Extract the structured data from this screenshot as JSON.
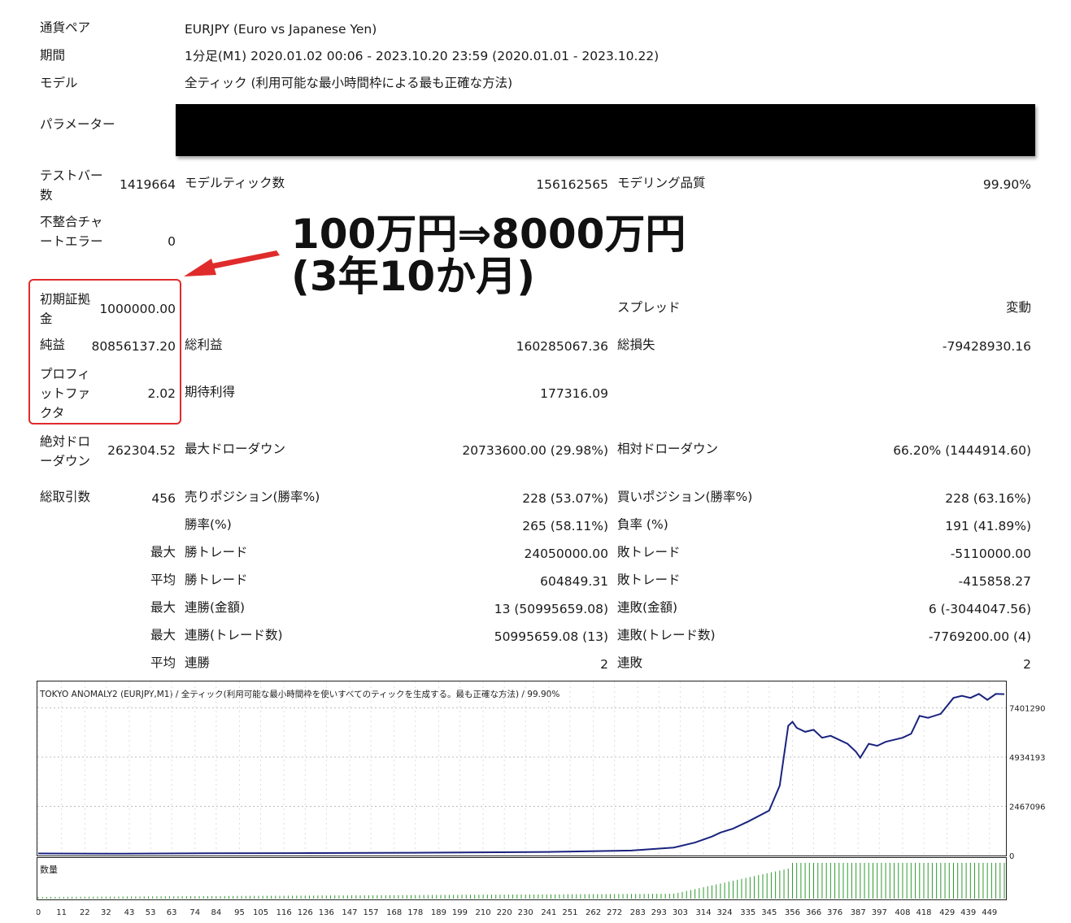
{
  "header": {
    "pair_label": "通貨ペア",
    "pair_value": "EURJPY (Euro vs Japanese Yen)",
    "period_label": "期間",
    "period_value": "1分足(M1) 2020.01.02 00:06 - 2023.10.20 23:59 (2020.01.01 - 2023.10.22)",
    "model_label": "モデル",
    "model_value": "全ティック (利用可能な最小時間枠による最も正確な方法)",
    "params_label": "パラメーター"
  },
  "stats": {
    "test_bars_label": "テストバー数",
    "test_bars_value": "1419664",
    "model_ticks_label": "モデルティック数",
    "model_ticks_value": "156162565",
    "modeling_quality_label": "モデリング品質",
    "modeling_quality_value": "99.90%",
    "mismatch_label": "不整合チャートエラー",
    "mismatch_value": "0",
    "initial_deposit_label": "初期証拠金",
    "initial_deposit_value": "1000000.00",
    "spread_label": "スプレッド",
    "spread_value": "変動",
    "net_profit_label": "純益",
    "net_profit_value": "80856137.20",
    "gross_profit_label": "総利益",
    "gross_profit_value": "160285067.36",
    "gross_loss_label": "総損失",
    "gross_loss_value": "-79428930.16",
    "profit_factor_label": "プロフィットファクタ",
    "profit_factor_value": "2.02",
    "expected_payoff_label": "期待利得",
    "expected_payoff_value": "177316.09",
    "abs_dd_label": "絶対ドローダウン",
    "abs_dd_value": "262304.52",
    "max_dd_label": "最大ドローダウン",
    "max_dd_value": "20733600.00 (29.98%)",
    "rel_dd_label": "相対ドローダウン",
    "rel_dd_value": "66.20% (1444914.60)",
    "total_trades_label": "総取引数",
    "total_trades_value": "456",
    "short_label": "売りポジション(勝率%)",
    "short_value": "228 (53.07%)",
    "long_label": "買いポジション(勝率%)",
    "long_value": "228 (63.16%)",
    "win_rate_label": "勝率(%)",
    "win_rate_value": "265 (58.11%)",
    "loss_rate_label": "負率 (%)",
    "loss_rate_value": "191 (41.89%)",
    "largest_label": "最大",
    "largest_win_label": "勝トレード",
    "largest_win_value": "24050000.00",
    "largest_loss_label": "敗トレード",
    "largest_loss_value": "-5110000.00",
    "average_label": "平均",
    "avg_win_label": "勝トレード",
    "avg_win_value": "604849.31",
    "avg_loss_label": "敗トレード",
    "avg_loss_value": "-415858.27",
    "max_consec_label": "最大",
    "max_consec_win_label": "連勝(金額)",
    "max_consec_win_value": "13 (50995659.08)",
    "max_consec_loss_label": "連敗(金額)",
    "max_consec_loss_value": "6 (-3044047.56)",
    "max_consec2_label": "最大",
    "max_consec_profit_label": "連勝(トレード数)",
    "max_consec_profit_value": "50995659.08 (13)",
    "max_consec_lossamt_label": "連敗(トレード数)",
    "max_consec_lossamt_value": "-7769200.00 (4)",
    "avg_consec_label": "平均",
    "avg_consec_win_label": "連勝",
    "avg_consec_win_value": "2",
    "avg_consec_loss_label": "連敗",
    "avg_consec_loss_value": "2"
  },
  "annotation": {
    "line1": "100万円⇒8000万円",
    "line2": "(3年10か月)",
    "box_color": "#e02b2b",
    "arrow_color": "#e02b2b"
  },
  "chart_data": {
    "type": "line",
    "title": "TOKYO ANOMALY2 (EURJPY,M1) / 全ティック(利用可能な最小時間枠を使いすべてのティックを生成する。最も正確な方法) / 99.90%",
    "volume_label": "数量",
    "y_tick_labels": [
      "7401290",
      "4934193",
      "2467096",
      "0"
    ],
    "y_ticks": [
      74012900,
      49341930,
      24670960,
      0
    ],
    "x_tick_labels": [
      "0",
      "11",
      "22",
      "32",
      "43",
      "53",
      "63",
      "74",
      "84",
      "95",
      "105",
      "116",
      "126",
      "136",
      "147",
      "157",
      "168",
      "178",
      "189",
      "199",
      "210",
      "220",
      "230",
      "241",
      "251",
      "262",
      "272",
      "283",
      "293",
      "303",
      "314",
      "324",
      "335",
      "345",
      "356",
      "366",
      "376",
      "387",
      "397",
      "408",
      "418",
      "429",
      "439",
      "449"
    ],
    "xlim": [
      0,
      456
    ],
    "ylim": [
      0,
      86000000
    ],
    "line_color": "#1a237e",
    "volume_color": "#2e9a2e",
    "series": [
      {
        "x": [
          0,
          40,
          80,
          120,
          160,
          200,
          240,
          280,
          300,
          310,
          318,
          322,
          328,
          335,
          345,
          350,
          354,
          356,
          358,
          362,
          366,
          370,
          374,
          378,
          382,
          386,
          388,
          392,
          396,
          400,
          404,
          408,
          412,
          416,
          420,
          426,
          432,
          436,
          440,
          444,
          448,
          452,
          456
        ],
        "y": [
          1000000,
          900000,
          1100000,
          1200000,
          1300000,
          1500000,
          1800000,
          2500000,
          4000000,
          6500000,
          9500000,
          11500000,
          13500000,
          17000000,
          22500000,
          35000000,
          65000000,
          67000000,
          64000000,
          62000000,
          63000000,
          59000000,
          60000000,
          58000000,
          56000000,
          52000000,
          49000000,
          56000000,
          55000000,
          57000000,
          58000000,
          59000000,
          61000000,
          70000000,
          69000000,
          71000000,
          79000000,
          80000000,
          79000000,
          81000000,
          78000000,
          81000000,
          80856137
        ]
      }
    ]
  }
}
